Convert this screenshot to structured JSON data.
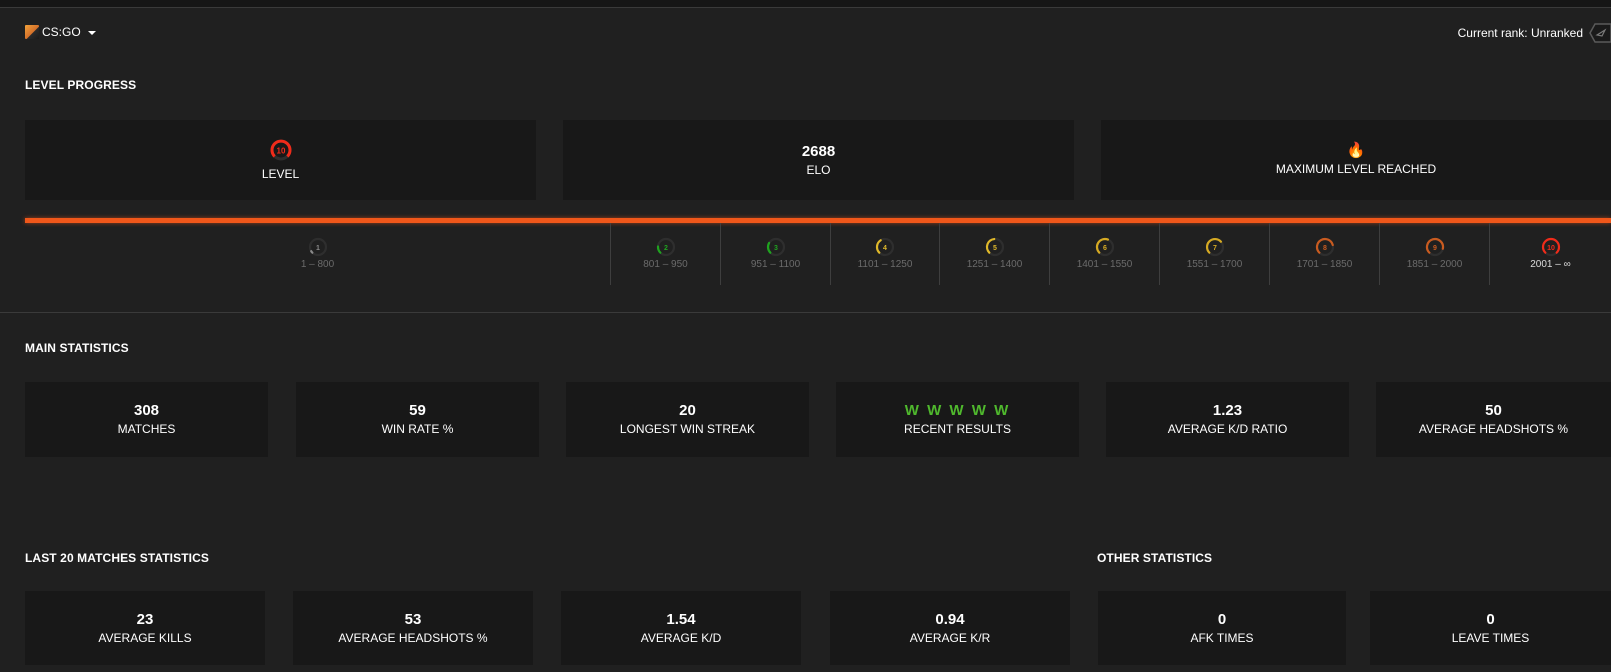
{
  "header": {
    "game": "CS:GO",
    "game_icon": "csgo-logo-icon",
    "rank_label": "Current rank: Unranked",
    "rank_icon": "unranked-badge-icon"
  },
  "level_progress": {
    "title": "LEVEL PROGRESS",
    "level": {
      "value": "10",
      "label": "LEVEL"
    },
    "elo": {
      "value": "2688",
      "label": "ELO"
    },
    "max": {
      "icon": "🔥",
      "label": "MAXIMUM LEVEL REACHED"
    },
    "progress_fraction": 1.0,
    "accent_color": "#f0571a",
    "levels": [
      {
        "level": "1",
        "range": "1 – 800",
        "color": "#8a8a8a",
        "fill": 0.05
      },
      {
        "level": "2",
        "range": "801 – 950",
        "color": "#1fa31f",
        "fill": 0.18
      },
      {
        "level": "3",
        "range": "951 – 1100",
        "color": "#1fa31f",
        "fill": 0.28
      },
      {
        "level": "4",
        "range": "1101 – 1250",
        "color": "#e0b92a",
        "fill": 0.38
      },
      {
        "level": "5",
        "range": "1251 – 1400",
        "color": "#e0b92a",
        "fill": 0.48
      },
      {
        "level": "6",
        "range": "1401 – 1550",
        "color": "#d6aa23",
        "fill": 0.58
      },
      {
        "level": "7",
        "range": "1551 – 1700",
        "color": "#d6aa23",
        "fill": 0.68
      },
      {
        "level": "8",
        "range": "1701 – 1850",
        "color": "#c95b20",
        "fill": 0.78
      },
      {
        "level": "9",
        "range": "1851 – 2000",
        "color": "#c95b20",
        "fill": 0.88
      },
      {
        "level": "10",
        "range": "2001 – ∞",
        "color": "#f02b1a",
        "fill": 1.0,
        "current": true
      }
    ]
  },
  "main_statistics": {
    "title": "MAIN STATISTICS",
    "cards": [
      {
        "value": "308",
        "label": "MATCHES"
      },
      {
        "value": "59",
        "label": "WIN RATE %"
      },
      {
        "value": "20",
        "label": "LONGEST WIN STREAK"
      },
      {
        "value": "W W W W W",
        "label": "RECENT RESULTS",
        "color": "#4fb82d"
      },
      {
        "value": "1.23",
        "label": "AVERAGE K/D RATIO"
      },
      {
        "value": "50",
        "label": "AVERAGE HEADSHOTS %"
      }
    ]
  },
  "last20": {
    "title": "LAST 20 MATCHES STATISTICS",
    "cards": [
      {
        "value": "23",
        "label": "AVERAGE KILLS"
      },
      {
        "value": "53",
        "label": "AVERAGE HEADSHOTS %"
      },
      {
        "value": "1.54",
        "label": "AVERAGE K/D"
      },
      {
        "value": "0.94",
        "label": "AVERAGE K/R"
      }
    ]
  },
  "other": {
    "title": "OTHER STATISTICS",
    "cards": [
      {
        "value": "0",
        "label": "AFK TIMES"
      },
      {
        "value": "0",
        "label": "LEAVE TIMES"
      }
    ]
  }
}
